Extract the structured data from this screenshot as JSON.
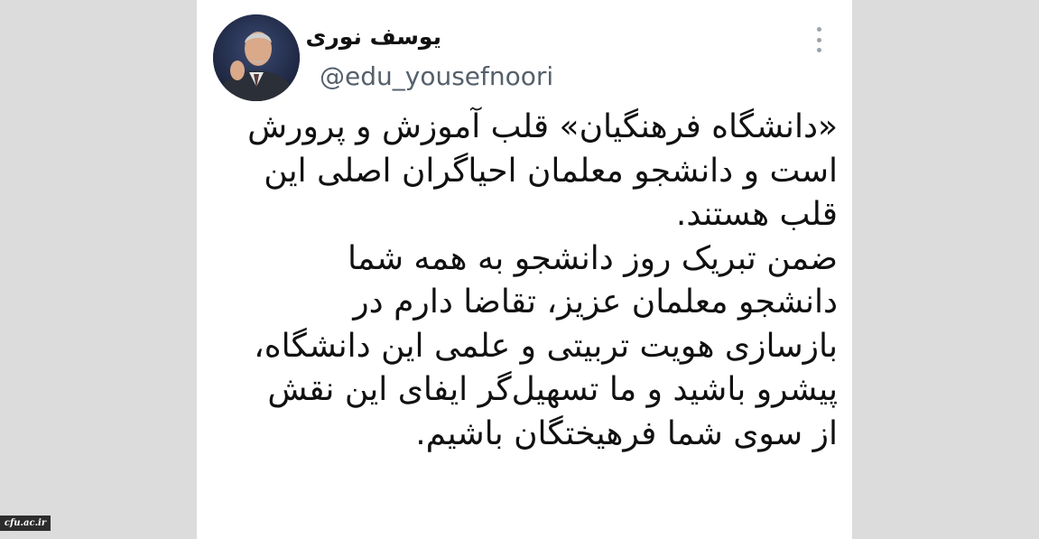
{
  "tweet": {
    "author_name": "یوسف نوری",
    "author_handle": "@edu_yousefnoori",
    "menu_icon": "more-vertical-icon",
    "text_lines": [
      "«دانشگاه فرهنگیان» قلب آموزش و پرورش",
      "است و دانشجو معلمان احیاگران اصلی این",
      "قلب هستند.",
      "ضمن تبریک روز دانشجو به همه شما",
      "دانشجو معلمان عزیز، تقاضا دارم در",
      "بازسازی هویت تربیتی و علمی این دانشگاه،",
      "پیشرو باشید و ما تسهیل‌گر ایفای این نقش",
      "از سوی شما فرهیختگان باشیم."
    ]
  },
  "watermark": {
    "text": "cfu.ac.ir"
  },
  "colors": {
    "background": "#dcdcdc",
    "card": "#ffffff",
    "text": "#111111",
    "handle": "#55606b"
  }
}
